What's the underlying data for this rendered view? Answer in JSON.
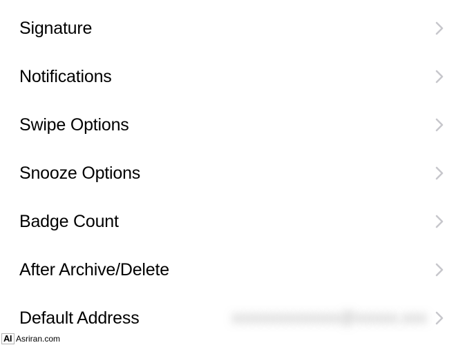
{
  "settings": {
    "items": [
      {
        "id": "signature",
        "label": "Signature",
        "value": ""
      },
      {
        "id": "notifications",
        "label": "Notifications",
        "value": ""
      },
      {
        "id": "swipe-options",
        "label": "Swipe Options",
        "value": ""
      },
      {
        "id": "snooze-options",
        "label": "Snooze Options",
        "value": ""
      },
      {
        "id": "badge-count",
        "label": "Badge Count",
        "value": ""
      },
      {
        "id": "after-archive-delete",
        "label": "After Archive/Delete",
        "value": ""
      },
      {
        "id": "default-address",
        "label": "Default Address",
        "value": "xxxxxxxxxxxxx@xxxxx.xxx"
      }
    ]
  },
  "watermark": {
    "logo": "AI",
    "text": "Asriran.com"
  }
}
